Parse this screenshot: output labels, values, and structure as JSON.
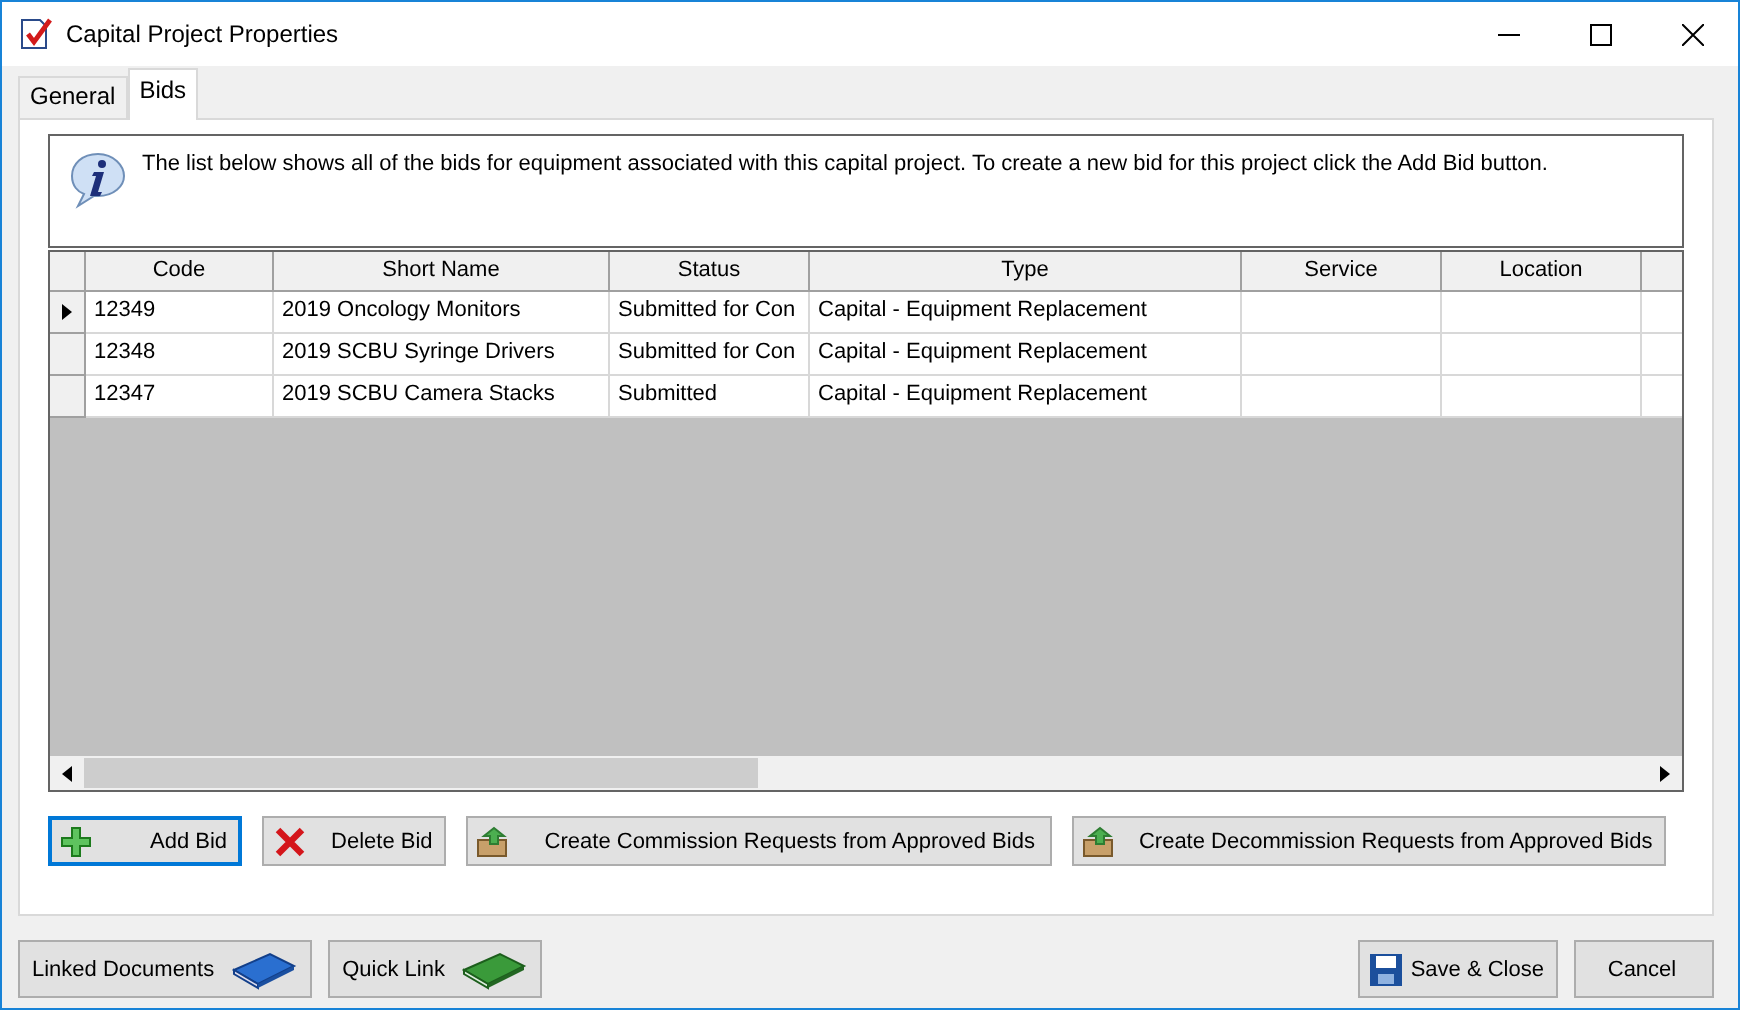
{
  "window": {
    "title": "Capital Project Properties"
  },
  "tabs": [
    {
      "label": "General",
      "selected": false
    },
    {
      "label": "Bids",
      "selected": true
    }
  ],
  "info": {
    "text": "The list below shows all of the bids for equipment associated with this capital project. To create a new bid for this project click the Add Bid button."
  },
  "table": {
    "columns": [
      "Code",
      "Short Name",
      "Status",
      "Type",
      "Service",
      "Location"
    ],
    "rows": [
      {
        "selected": true,
        "cells": [
          "12349",
          "2019 Oncology Monitors",
          "Submitted for Con",
          "Capital - Equipment Replacement",
          "",
          ""
        ]
      },
      {
        "selected": false,
        "cells": [
          "12348",
          "2019 SCBU Syringe Drivers",
          "Submitted for Con",
          "Capital - Equipment Replacement",
          "",
          ""
        ]
      },
      {
        "selected": false,
        "cells": [
          "12347",
          "2019 SCBU Camera Stacks",
          "Submitted",
          "Capital - Equipment Replacement",
          "",
          ""
        ]
      }
    ]
  },
  "actions": [
    {
      "kind": "add",
      "label": "Add Bid",
      "focused": true
    },
    {
      "kind": "delete",
      "label": "Delete Bid",
      "focused": false
    },
    {
      "kind": "box",
      "label": "Create Commission Requests from Approved Bids",
      "focused": false
    },
    {
      "kind": "box",
      "label": "Create Decommission Requests from Approved Bids",
      "focused": false
    }
  ],
  "footer_left": [
    {
      "kind": "blue-book",
      "label": "Linked Documents"
    },
    {
      "kind": "green-book",
      "label": "Quick Link"
    }
  ],
  "footer_right": [
    {
      "kind": "save",
      "label": "Save & Close"
    },
    {
      "kind": "plain",
      "label": "Cancel"
    }
  ]
}
